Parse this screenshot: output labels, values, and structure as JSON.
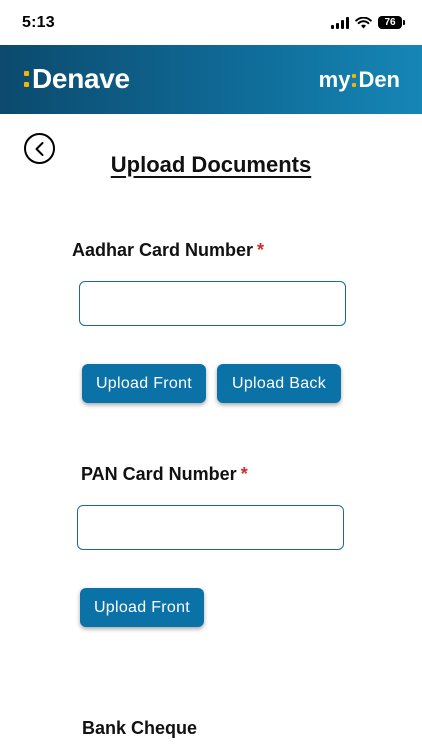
{
  "status": {
    "time": "5:13",
    "battery": "76"
  },
  "header": {
    "brand_left": "Denave",
    "brand_right_prefix": "my",
    "brand_right_suffix": "Den",
    "colors": {
      "header_start": "#0c4a6e",
      "header_end": "#1686b6",
      "accent_dots": "#f5b400"
    }
  },
  "page": {
    "title": "Upload Documents",
    "back_icon": "chevron-left-circle-icon"
  },
  "aadhar": {
    "label": "Aadhar Card Number",
    "required_mark": "*",
    "value": "",
    "upload_front": "Upload Front",
    "upload_back": "Upload Back"
  },
  "pan": {
    "label": "PAN Card Number",
    "required_mark": "*",
    "value": "",
    "upload_front": "Upload Front"
  },
  "bank": {
    "label": "Bank Cheque"
  },
  "colors": {
    "button": "#0b72a8",
    "input_border": "#1b6b94",
    "required": "#d62828"
  }
}
